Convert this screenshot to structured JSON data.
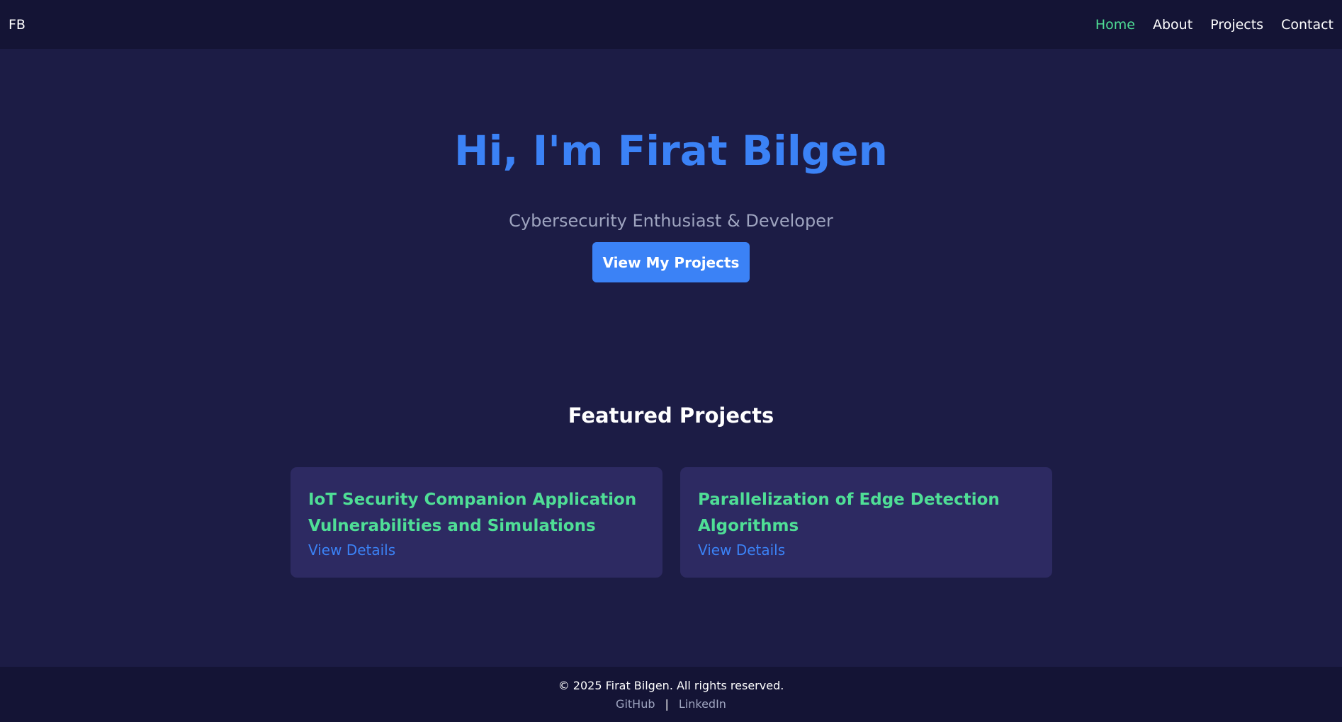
{
  "nav": {
    "brand": "FB",
    "links": [
      {
        "label": "Home",
        "active": true
      },
      {
        "label": "About"
      },
      {
        "label": "Projects"
      },
      {
        "label": "Contact"
      }
    ]
  },
  "hero": {
    "title": "Hi, I'm Firat Bilgen",
    "subtitle": "Cybersecurity Enthusiast & Developer",
    "cta_label": "View My Projects"
  },
  "featured": {
    "heading": "Featured Projects",
    "projects": [
      {
        "title_line1": "IoT Security Companion Application",
        "title_line2": "Vulnerabilities and Simulations",
        "link_label": "View Details"
      },
      {
        "title_line1": "Parallelization of Edge Detection",
        "title_line2": "Algorithms",
        "link_label": "View Details"
      }
    ]
  },
  "footer": {
    "copyright": "© 2025 Firat Bilgen. All rights reserved.",
    "github_label": "GitHub",
    "separator": "|",
    "linkedin_label": "LinkedIn"
  },
  "colors": {
    "background": "#1c1c45",
    "navbar": "#141435",
    "accent_blue": "#3b82f6",
    "accent_green": "#4fde96",
    "card": "#2d2a62"
  }
}
